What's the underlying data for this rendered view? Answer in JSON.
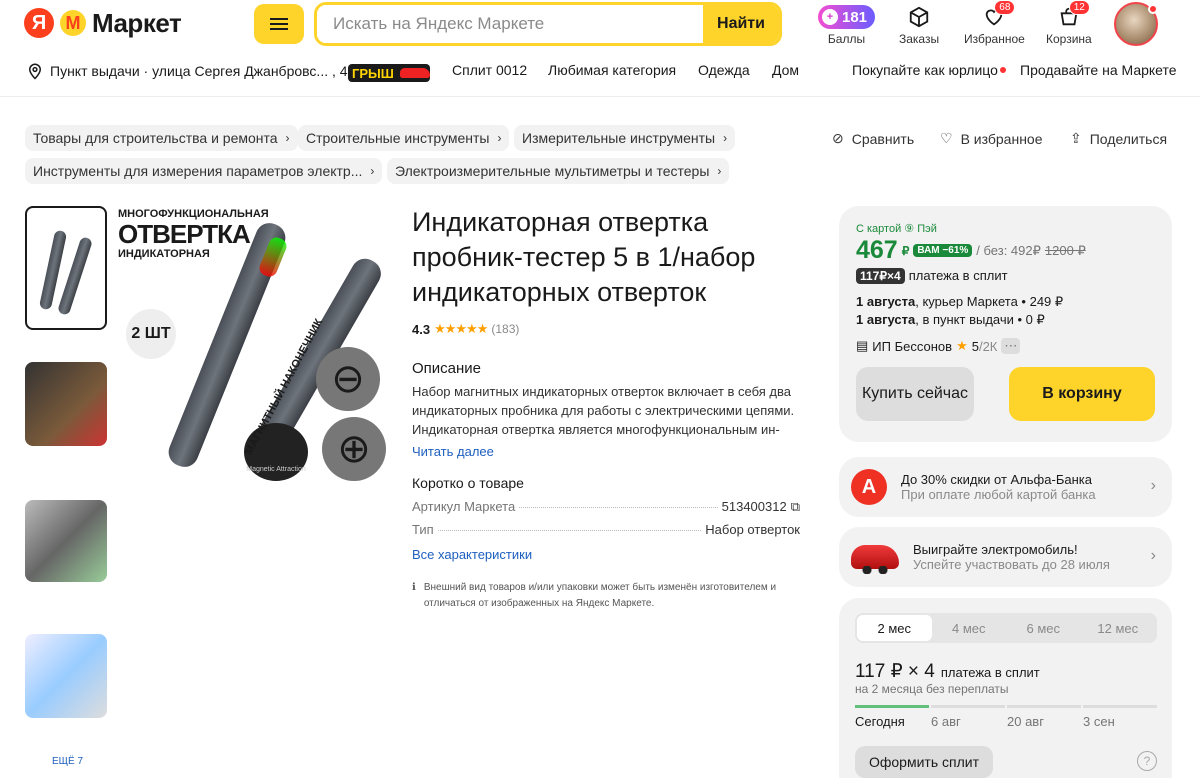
{
  "header": {
    "logo_text": "Маркет",
    "search_placeholder": "Искать на Яндекс Маркете",
    "search_button": "Найти",
    "balls_count": "181",
    "balls_label": "Баллы",
    "orders_label": "Заказы",
    "favorites_label": "Избранное",
    "favorites_badge": "68",
    "cart_label": "Корзина",
    "cart_badge": "12"
  },
  "subnav": {
    "pickup": "Пункт выдачи · улица Сергея Джанбровс... , 4",
    "promo_badge": "ГРЫШ",
    "items": [
      "Сплит 0012",
      "Любимая категория",
      "Одежда",
      "Дом"
    ],
    "legal": "Покупайте как юрлицо",
    "sell": "Продавайте на Маркете"
  },
  "breadcrumbs": [
    "Товары для строительства и ремонта",
    "Строительные инструменты",
    "Измерительные инструменты",
    "Инструменты для измерения параметров электр...",
    "Электроизмерительные мультиметры и тестеры"
  ],
  "actions": {
    "compare": "Сравнить",
    "favorite": "В избранное",
    "share": "Поделиться"
  },
  "gallery": {
    "more": "ЕЩЁ 7",
    "main_caption_1": "МНОГОФУНКЦИОНАЛЬНАЯ",
    "main_caption_2": "ОТВЕРТКА",
    "main_caption_3": "ИНДИКАТОРНАЯ",
    "count_label": "2 ШТ",
    "tip_label": "МАГНИТНЫЙ НАКОНЕЧНИК",
    "magnetic_label": "Magnetic Attraction"
  },
  "product": {
    "title": "Индикаторная отвертка пробник-тестер 5 в 1/набор индикаторных отверток",
    "rating": "4.3",
    "stars": "★★★★★",
    "reviews": "(183)",
    "desc_heading": "Описание",
    "description": "Набор магнитных индикаторных отверток включает в себя два индикаторных пробника для работы с электрическими цепями. Индикаторная отвертка является многофункциональным ин-",
    "read_more": "Читать далее",
    "short_heading": "Коротко о товаре",
    "sku_label": "Артикул Маркета",
    "sku_value": "513400312",
    "type_label": "Тип",
    "type_value": "Набор отверток",
    "all_specs": "Все характеристики",
    "note": "Внешний вид товаров и/или упаковки может быть изменён изготовителем и отличаться от изображенных на Яндекс Маркете."
  },
  "buy": {
    "card_label": "С картой ⑨ Пэй",
    "price": "467",
    "currency": "₽",
    "discount": "ВАМ −61%",
    "without": "/ без: 492₽",
    "old_price": "1200 ₽",
    "split_price": "117₽×4",
    "split_text": "платежа в сплит",
    "delivery1_date": "1 августа",
    "delivery1_text": ", курьер Маркета • 249 ₽",
    "delivery2_date": "1 августа",
    "delivery2_text": ", в пункт выдачи • 0 ₽",
    "seller": "ИП Бессонов",
    "seller_rating": "5",
    "seller_reviews": "/2К",
    "buy_now": "Купить сейчас",
    "to_cart": "В корзину"
  },
  "promos": [
    {
      "title": "До 30% скидки от Альфа-Банка",
      "sub": "При оплате любой картой банка"
    },
    {
      "title": "Выиграйте электромобиль!",
      "sub": "Успейте участвовать до 28 июля"
    }
  ],
  "split": {
    "tabs": [
      "2 мес",
      "4 мес",
      "6 мес",
      "12 мес"
    ],
    "amount": "117 ₽ × 4",
    "amount_suffix": "платежа в сплит",
    "sub": "на 2 месяца без переплаты",
    "schedule": [
      "Сегодня",
      "6 авг",
      "20 авг",
      "3 сен"
    ],
    "button": "Оформить сплит",
    "help": "?"
  },
  "colors": {
    "brand_yellow": "#fed42b",
    "price_green": "#1a8a3a",
    "badge_red": "#f33"
  }
}
